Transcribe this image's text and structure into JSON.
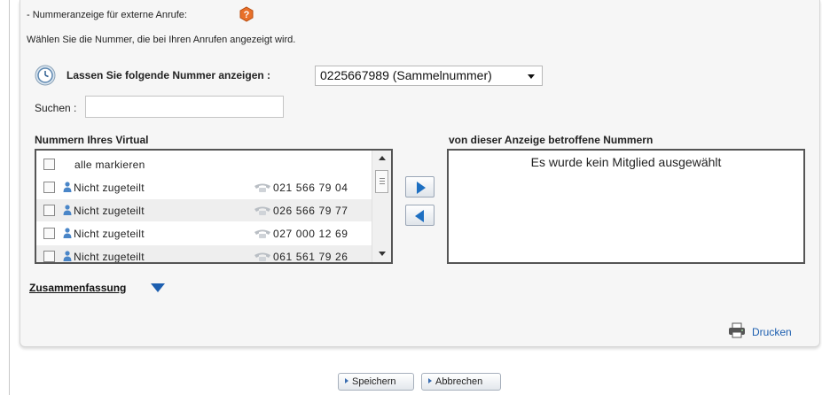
{
  "header": {
    "title": "- Nummeranzeige für externe Anrufe:",
    "description": "Wählen Sie die Nummer, die bei Ihren Anrufen angezeigt wird."
  },
  "display_number": {
    "label": "Lassen Sie folgende Nummer anzeigen :",
    "selected": "0225667989 (Sammelnummer)"
  },
  "search": {
    "label": "Suchen :",
    "value": ""
  },
  "numbers_list": {
    "title": "Nummern Ihres Virtual",
    "select_all_label": "alle markieren",
    "rows": [
      {
        "name": "Nicht zugeteilt",
        "number": "021 566 79 04"
      },
      {
        "name": "Nicht zugeteilt",
        "number": "026 566 79 77"
      },
      {
        "name": "Nicht zugeteilt",
        "number": "027 000 12 69"
      },
      {
        "name": "Nicht zugeteilt",
        "number": "061 561 79 26"
      }
    ]
  },
  "affected": {
    "title": "von dieser Anzeige betroffene Nummern",
    "empty_text": "Es wurde kein Mitglied ausgewählt"
  },
  "summary": {
    "label": "Zusammenfassung"
  },
  "print": {
    "label": "Drucken"
  },
  "actions": {
    "save_label": "Speichern",
    "cancel_label": "Abbrechen"
  },
  "colors": {
    "accent_blue": "#1d6fc2",
    "link_blue": "#1d5fb0",
    "info_icon_orange": "#e8702a"
  },
  "icons": [
    "info-icon",
    "clock-icon",
    "user-icon",
    "phone-icon",
    "arrow-right-icon",
    "arrow-left-icon",
    "chevron-down-icon",
    "printer-icon"
  ]
}
